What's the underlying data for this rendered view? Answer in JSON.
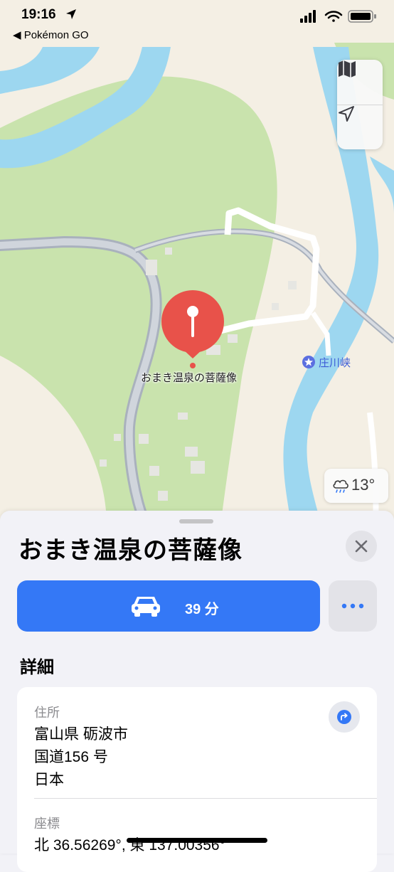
{
  "status_bar": {
    "time": "19:16",
    "back_app": "◀ Pokémon GO"
  },
  "map": {
    "place_label": "おまき温泉の菩薩像",
    "nearby_label": "庄川峡",
    "weather_temp": "13°",
    "colors": {
      "water": "#9dd7f0",
      "park": "#c9e3ad",
      "land": "#f4efe4",
      "road": "#a9b1bd",
      "pin": "#e8524a"
    }
  },
  "sheet": {
    "title": "おまき温泉の菩薩像",
    "directions_label": "39 分",
    "details_heading": "詳細",
    "address_label": "住所",
    "address_lines": [
      "富山県 砺波市",
      "国道156 号",
      "日本"
    ],
    "coords_label": "座標",
    "coords_value": "北 36.56269°, 東 137.00356°"
  },
  "colors": {
    "accent": "#3478f6",
    "sheet_bg": "#f2f2f7"
  }
}
